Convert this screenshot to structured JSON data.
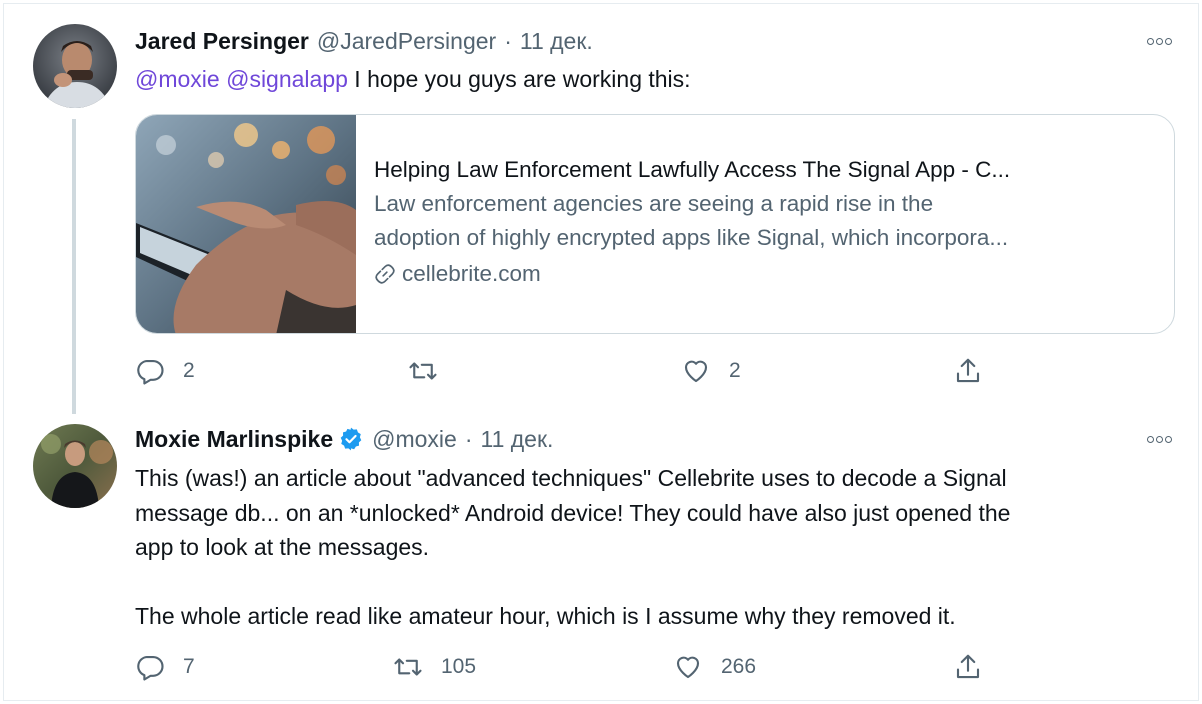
{
  "tweets": [
    {
      "author": {
        "name": "Jared Persinger",
        "handle": "@JaredPersinger",
        "separator": "·",
        "date": "11 дек.",
        "verified": false
      },
      "text": {
        "mention_1": "@moxie",
        "mention_2": "@signalapp",
        "body": " I hope you guys are working this:"
      },
      "link_card": {
        "title": "Helping Law Enforcement Lawfully Access The Signal App - C...",
        "description_line_1": "Law enforcement agencies are seeing a rapid rise in the",
        "description_line_2": "adoption of highly encrypted apps like Signal, which incorpora...",
        "domain": "cellebrite.com",
        "image_icon": "phone-photo-image"
      },
      "actions": {
        "reply_count": "2",
        "retweet_count": "",
        "like_count": "2"
      }
    },
    {
      "author": {
        "name": "Moxie Marlinspike",
        "handle": "@moxie",
        "separator": "·",
        "date": "11 дек.",
        "verified": true
      },
      "text": {
        "line_1": "This (was!) an article about \"advanced techniques\" Cellebrite uses to decode a Signal",
        "line_2": "message db... on an *unlocked* Android device! They could have also just opened the",
        "line_3": "app to look at the messages.",
        "line_4": "The whole article read like amateur hour, which is I assume why they removed it."
      },
      "actions": {
        "reply_count": "7",
        "retweet_count": "105",
        "like_count": "266"
      }
    }
  ],
  "colors": {
    "mention": "#6f47d9",
    "verified": "#1d9bf0",
    "secondary_text": "#536471",
    "border": "#cfd9de"
  },
  "icons": [
    "reply-icon",
    "retweet-icon",
    "like-icon",
    "share-icon",
    "more-icon",
    "verified-badge-icon",
    "link-icon"
  ]
}
